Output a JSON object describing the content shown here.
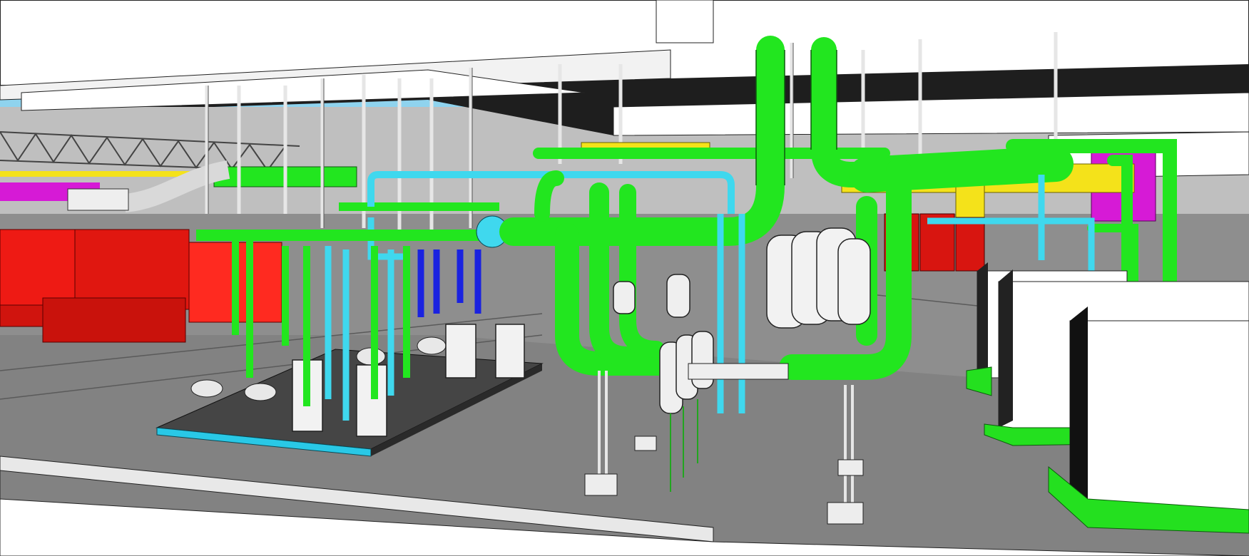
{
  "scene": {
    "kind": "3d-bim-model-render",
    "colors": {
      "sky": "#8fd3ee",
      "floor": "#8e8e8e",
      "slab_light": "#ffffff",
      "slab_shadow": "#1e1e1e",
      "green_pipe": "#22e61f",
      "cyan_pipe": "#3fd8ee",
      "blue_pipe": "#1a22e0",
      "red_equipment": "#ee1a14",
      "yellow_duct": "#f4e21a",
      "magenta_duct": "#d61ad6",
      "silver_duct": "#d9d9d9",
      "skid_base": "#454545",
      "skid_edge": "#29c8e6",
      "housekeeping_pad": "#24e01f"
    },
    "objects": {
      "pump_skid": "pump-skid",
      "heat_exchangers": "plate-heat-exchanger",
      "vessels": "vertical-tank",
      "air_separators": "air-separator",
      "chillers": "chiller-unit",
      "red_pumps": "red-pump-cluster"
    }
  }
}
